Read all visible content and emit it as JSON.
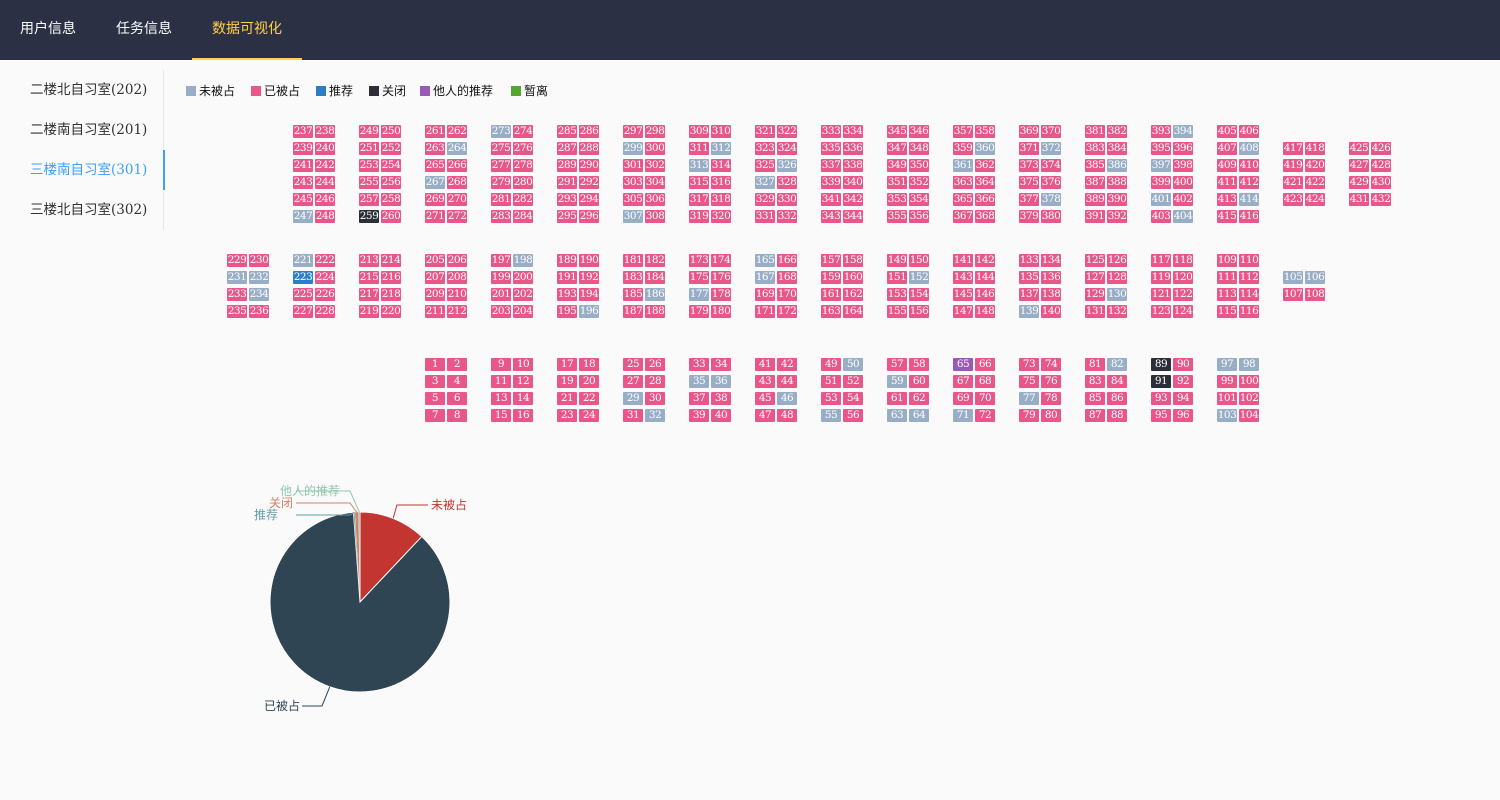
{
  "nav": {
    "tabs": [
      {
        "label": "用户信息"
      },
      {
        "label": "任务信息"
      },
      {
        "label": "数据可视化"
      }
    ]
  },
  "sidebar": {
    "items": [
      {
        "label": "二楼北自习室(202)"
      },
      {
        "label": "二楼南自习室(201)"
      },
      {
        "label": "三楼南自习室(301)"
      },
      {
        "label": "三楼北自习室(302)"
      }
    ]
  },
  "legend": [
    {
      "key": "free",
      "label": "未被占",
      "color": "#98aec7"
    },
    {
      "key": "occupied",
      "label": "已被占",
      "color": "#e8568a"
    },
    {
      "key": "recommended",
      "label": "推荐",
      "color": "#2b7fc6"
    },
    {
      "key": "closed",
      "label": "关闭",
      "color": "#2c2f37"
    },
    {
      "key": "others_rec",
      "label": "他人的推荐",
      "color": "#9b59b6"
    },
    {
      "key": "away",
      "label": "暂离",
      "color": "#55a630"
    }
  ],
  "seat_layout": {
    "free": [
      273,
      394,
      408,
      312,
      326,
      360,
      313,
      386,
      397,
      267,
      327,
      378,
      307,
      401,
      404,
      264,
      299,
      372,
      361,
      414,
      247,
      221,
      198,
      231,
      232,
      234,
      186,
      165,
      167,
      177,
      130,
      152,
      196,
      139,
      105,
      106,
      82,
      97,
      35,
      36,
      50,
      59,
      77,
      29,
      46,
      63,
      64,
      71,
      103,
      98,
      55,
      32
    ],
    "recommended": [
      223
    ],
    "closed": [
      259,
      89,
      91
    ],
    "others_rec": [
      65
    ],
    "away": []
  },
  "chart_data": {
    "type": "pie",
    "series": [
      {
        "name": "未被占",
        "value": 52,
        "color": "#c23531"
      },
      {
        "name": "已被占",
        "value": 375,
        "color": "#2f4554"
      },
      {
        "name": "推荐",
        "value": 1,
        "color": "#61a0a8"
      },
      {
        "name": "关闭",
        "value": 3,
        "color": "#d48265"
      },
      {
        "name": "他人的推荐",
        "value": 1,
        "color": "#91c7ae"
      }
    ]
  }
}
